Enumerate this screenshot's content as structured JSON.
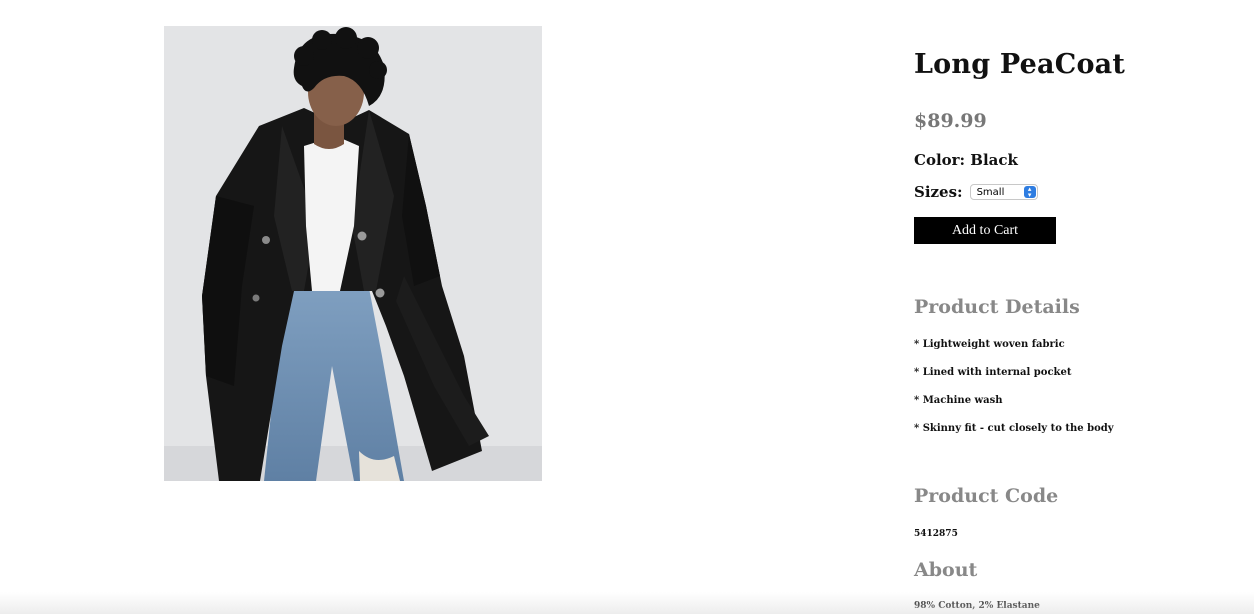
{
  "product": {
    "image_alt": "Model wearing black trench coat over white tee and ripped light-wash jeans",
    "title": "Long PeaCoat",
    "price": "$89.99",
    "color_label": "Color: Black",
    "sizes_label": "Sizes:",
    "selected_size": "Small",
    "add_to_cart_label": "Add to Cart"
  },
  "details": {
    "heading": "Product Details",
    "items": [
      "* Lightweight woven fabric",
      "* Lined with internal pocket",
      "* Machine wash",
      "* Skinny fit - cut closely to the body"
    ]
  },
  "code": {
    "heading": "Product Code",
    "value": "5412875"
  },
  "about": {
    "heading": "About",
    "text": "98% Cotton, 2% Elastane"
  },
  "colors": {
    "button_bg": "#000000",
    "heading_gray": "#888888",
    "price_gray": "#777777",
    "select_accent": "#2f7de1"
  },
  "icons": {
    "select_arrow": "chevron-updown-icon"
  }
}
